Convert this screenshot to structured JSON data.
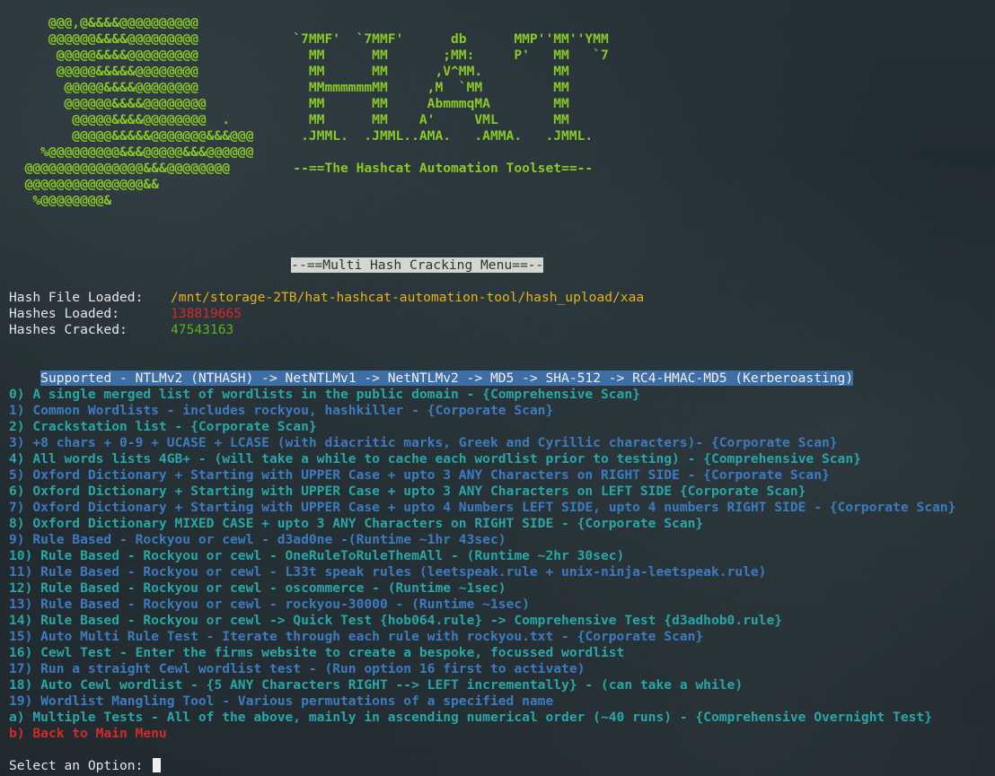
{
  "ascii_art": [
    "     @@@,@&&&&@@@@@@@@@@",
    "     @@@@@@&&&&@@@@@@@@@            `7MMF'  `7MMF'      db      MMP''MM''YMM",
    "      @@@@@&&&&@@@@@@@@@              MM      MM       ;MM:     P'   MM   `7",
    "      @@@@@&&&&&@@@@@@@@              MM      MM      ,V^MM.         MM",
    "       @@@@@&&&&@@@@@@@@              MMmmmmmmMM     ,M  `MM         MM",
    "       @@@@@@&&&&@@@@@@@@             MM      MM     AbmmmqMA        MM",
    "        @@@@@&&&&@@@@@@@@  .          MM      MM    A'     VML       MM",
    "        @@@@@&&&&&@@@@@@@&&&@@@      .JMML.  .JMML..AMA.   .AMMA.   .JMML.",
    "    %@@@@@@@@@&&&@@@@@&&&@@@@@@",
    "  @@@@@@@@@@@@@@@&&&@@@@@@@@        --==The Hashcat Automation Toolset==--",
    "  @@@@@@@@@@@@@@@&&",
    "   %@@@@@@@@&"
  ],
  "menu_title": "--==Multi Hash Cracking Menu==--",
  "status": {
    "hash_file_label": "Hash File Loaded:",
    "hash_file_value": "/mnt/storage-2TB/hat-hashcat-automation-tool/hash_upload/xaa",
    "hashes_loaded_label": "Hashes Loaded:",
    "hashes_loaded_value": "138819665",
    "hashes_cracked_label": "Hashes Cracked:",
    "hashes_cracked_value": "47543163"
  },
  "supported": "Supported - NTLMv2 (NTHASH) -> NetNTLMv1 -> NetNTLMv2 -> MD5 -> SHA-512 -> RC4-HMAC-MD5 (Kerberoasting)",
  "options": [
    {
      "text": "0) A single merged list of wordlists in the public domain - {Comprehensive Scan}",
      "color": "#2aa6a6"
    },
    {
      "text": "1) Common Wordlists - includes rockyou, hashkiller - {Corporate Scan}",
      "color": "#3d7bc1"
    },
    {
      "text": "2) Crackstation list - {Corporate Scan}",
      "color": "#2aa6a6"
    },
    {
      "text": "3) +8 chars + 0-9 + UCASE + LCASE (with diacritic marks, Greek and Cyrillic characters)- {Corporate Scan}",
      "color": "#3d7bc1"
    },
    {
      "text": "4) All words lists 4GB+ - (will take a while to cache each wordlist prior to testing) - {Comprehensive Scan}",
      "color": "#2aa6a6"
    },
    {
      "text": "5) Oxford Dictionary + Starting with UPPER Case + upto 3 ANY Characters on RIGHT SIDE - {Corporate Scan}",
      "color": "#3d7bc1"
    },
    {
      "text": "6) Oxford Dictionary + Starting with UPPER Case + upto 3 ANY Characters on LEFT SIDE {Corporate Scan}",
      "color": "#2aa6a6"
    },
    {
      "text": "7) Oxford Dictionary + Starting with UPPER Case + upto 4 Numbers LEFT SIDE, upto 4 numbers RIGHT SIDE - {Corporate Scan}",
      "color": "#3d7bc1"
    },
    {
      "text": "8) Oxford Dictionary MIXED CASE + upto 3 ANY Characters on RIGHT SIDE - {Corporate Scan}",
      "color": "#2aa6a6"
    },
    {
      "text": "9) Rule Based - Rockyou or cewl - d3ad0ne -(Runtime ~1hr 43sec)",
      "color": "#3d7bc1"
    },
    {
      "text": "10) Rule Based - Rockyou or cewl - OneRuleToRuleThemAll - (Runtime ~2hr 30sec)",
      "color": "#2aa6a6"
    },
    {
      "text": "11) Rule Based - Rockyou or cewl - L33t speak rules (leetspeak.rule + unix-ninja-leetspeak.rule)",
      "color": "#3d7bc1"
    },
    {
      "text": "12) Rule Based - Rockyou or cewl - oscommerce - (Runtime ~1sec)",
      "color": "#2aa6a6"
    },
    {
      "text": "13) Rule Based - Rockyou or cewl - rockyou-30000 - (Runtime ~1sec)",
      "color": "#3d7bc1"
    },
    {
      "text": "14) Rule Based - Rockyou or cewl -> Quick Test {hob064.rule} -> Comprehensive Test {d3adhob0.rule}",
      "color": "#2aa6a6"
    },
    {
      "text": "15) Auto Multi Rule Test - Iterate through each rule with rockyou.txt - {Corporate Scan}",
      "color": "#3d7bc1"
    },
    {
      "text": "16) Cewl Test - Enter the firms website to create a bespoke, focussed wordlist",
      "color": "#2aa6a6"
    },
    {
      "text": "17) Run a straight Cewl wordlist test - (Run option 16 first to activate)",
      "color": "#3d7bc1"
    },
    {
      "text": "18) Auto Cewl wordlist - {5 ANY Characters RIGHT --> LEFT incrementally} - (can take a while)",
      "color": "#2aa6a6"
    },
    {
      "text": "19) Wordlist Mangling Tool - Various permutations of a specified name",
      "color": "#3d7bc1"
    },
    {
      "text": "a) Multiple Tests - All of the above, mainly in ascending numerical order (~40 runs) - {Comprehensive Overnight Test}",
      "color": "#2aa6a6"
    },
    {
      "text": "b) Back to Main Menu",
      "color": "#d52a2a"
    }
  ],
  "prompt": "Select an Option: "
}
